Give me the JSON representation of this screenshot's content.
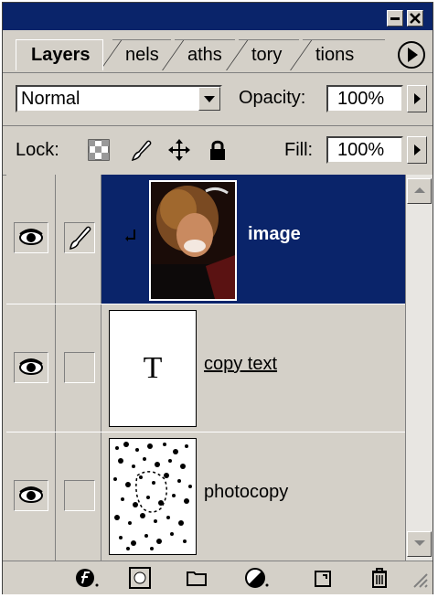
{
  "window": {
    "minimize_icon": "minimize-icon",
    "close_icon": "close-icon"
  },
  "tabs": [
    {
      "label": "Layers",
      "active": true
    },
    {
      "label": "nels",
      "active": false
    },
    {
      "label": "aths",
      "active": false
    },
    {
      "label": "tory",
      "active": false
    },
    {
      "label": "tions",
      "active": false
    }
  ],
  "blend_mode": {
    "value": "Normal"
  },
  "opacity": {
    "label": "Opacity:",
    "value": "100%"
  },
  "lock": {
    "label": "Lock:"
  },
  "fill": {
    "label": "Fill:",
    "value": "100%"
  },
  "layers": [
    {
      "name": "image",
      "selected": true,
      "visible": true,
      "kind": "image"
    },
    {
      "name": "copy text",
      "selected": false,
      "visible": true,
      "kind": "text",
      "thumb_glyph": "T"
    },
    {
      "name": "photocopy",
      "selected": false,
      "visible": true,
      "kind": "image"
    }
  ],
  "colors": {
    "selection": "#0a246a",
    "panel": "#d4d0c8"
  },
  "bottom_icons": [
    "layer-style-icon",
    "mask-icon",
    "folder-icon",
    "adjustment-layer-icon",
    "new-layer-icon",
    "trash-icon"
  ]
}
